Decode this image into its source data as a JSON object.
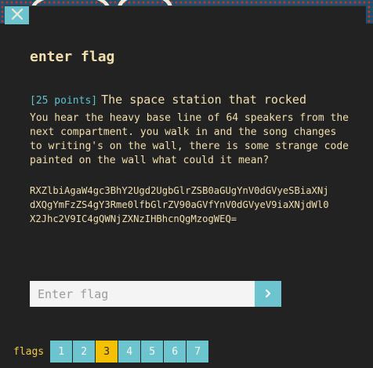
{
  "modal": {
    "title": "enter flag",
    "challenge": {
      "points": "[25 points]",
      "name": "The space station that rocked",
      "description": "You hear the heavy base line of 64 speakers from the\nnext compartment. you walk in and the song changes\nto writing's on the wall, there is some strange code\npainted on the wall what could it mean?",
      "code": "RXZlbiAgaW4gc3BhY2Ugd2UgbGlrZSB0aGUgYnV0dGVyeSBiaXNj\ndXQgYmFzZS4gY3Rme0lfbGlrZV90aGVfYnV0dGVyeV9iaXNjdWl0\nX2Jhc2V9IC4gQWNjZXNzIHBhcnQgMzogWEQ="
    },
    "input": {
      "placeholder": "Enter flag",
      "value": ""
    },
    "submit_icon": "chevron-right-icon",
    "close_icon": "close-icon"
  },
  "pager": {
    "label": "flags",
    "pages": [
      "1",
      "2",
      "3",
      "4",
      "5",
      "6",
      "7"
    ],
    "active": "3"
  },
  "colors": {
    "accent": "#6cc4cf",
    "active": "#f5c000",
    "text": "#f2dfae",
    "points": "#5fc3cc",
    "background": "#222222"
  }
}
